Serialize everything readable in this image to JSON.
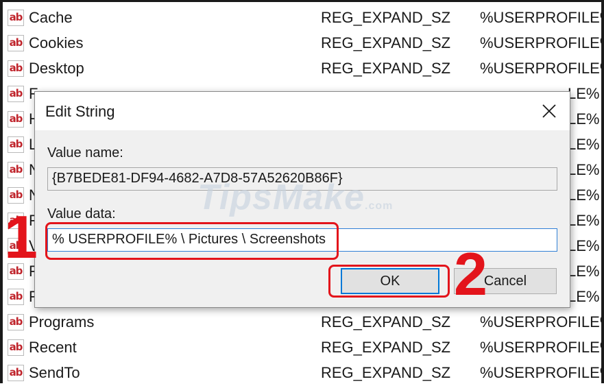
{
  "registry": {
    "rows_top": [
      {
        "name": "Cache",
        "type": "REG_EXPAND_SZ",
        "data": "%USERPROFILE%"
      },
      {
        "name": "Cookies",
        "type": "REG_EXPAND_SZ",
        "data": "%USERPROFILE%"
      },
      {
        "name": "Desktop",
        "type": "REG_EXPAND_SZ",
        "data": "%USERPROFILE%"
      }
    ],
    "rows_bottom": [
      {
        "name": "Programs",
        "type": "REG_EXPAND_SZ",
        "data": "%USERPROFILE%"
      },
      {
        "name": "Recent",
        "type": "REG_EXPAND_SZ",
        "data": "%USERPROFILE%"
      },
      {
        "name": "SendTo",
        "type": "REG_EXPAND_SZ",
        "data": "%USERPROFILE%"
      }
    ],
    "hidden_row_initials": [
      "F",
      "H",
      "L",
      "N",
      "N",
      "F",
      "V",
      "F",
      "F"
    ],
    "hidden_row_data_tail": [
      "LE%",
      "LE%",
      "LE%",
      "LE%",
      "LE%",
      "LE%",
      "LE%",
      "LE%",
      "LE%"
    ],
    "icon_text": "ab"
  },
  "dialog": {
    "title": "Edit String",
    "value_name_label": "Value name:",
    "value_name": "{B7BEDE81-DF94-4682-A7D8-57A52620B86F}",
    "value_data_label": "Value data:",
    "value_data": "% USERPROFILE% \\ Pictures \\ Screenshots",
    "ok_label": "OK",
    "cancel_label": "Cancel"
  },
  "annotations": {
    "step1": "1",
    "step2": "2",
    "color": "#e3141b"
  },
  "watermark": {
    "text": "TipsMake",
    "suffix": ".com"
  },
  "icons": [
    "reg-sz-icon",
    "close-icon"
  ]
}
